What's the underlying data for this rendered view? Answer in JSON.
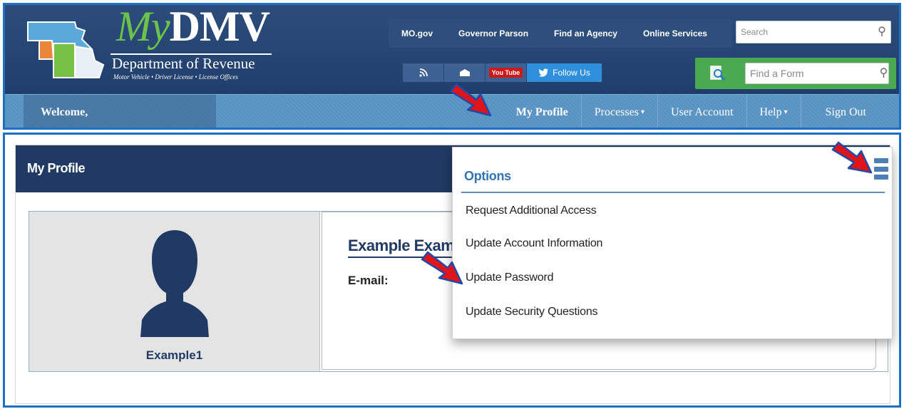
{
  "header": {
    "brand_my": "My",
    "brand_dmv": "DMV",
    "department": "Department of Revenue",
    "tagline": "Motor Vehicle  •  Driver License  •  License Offices",
    "util_links": [
      "MO.gov",
      "Governor Parson",
      "Find an Agency",
      "Online Services"
    ],
    "site_search_placeholder": "Search",
    "social": {
      "rss_glyph": "ᖇ",
      "mail_glyph": "⏏",
      "youtube_label": "You Tube",
      "follow_label": "Follow Us"
    },
    "form_search_placeholder": "Find a Form"
  },
  "nav": {
    "welcome": "Welcome,",
    "items": [
      {
        "label": "My Profile"
      },
      {
        "label": "Processes",
        "dropdown": true
      },
      {
        "label": "User Account"
      },
      {
        "label": "Help",
        "dropdown": true
      },
      {
        "label": "Sign Out"
      }
    ]
  },
  "profile": {
    "title": "My Profile",
    "username": "Example1",
    "full_name": "Example Example",
    "email_label": "E-mail:"
  },
  "options_menu": {
    "title": "Options",
    "items": [
      "Request Additional Access",
      "Update Account Information",
      "Update Password",
      "Update Security Questions"
    ]
  },
  "colors": {
    "header_blue": "#213a63",
    "nav_blue": "#5f98c6",
    "accent_green": "#4aaa52",
    "frame_blue": "#1e6fc6",
    "arrow_red": "#e0141b"
  },
  "icons": [
    "search-icon",
    "rss-icon",
    "mail-icon",
    "youtube-icon",
    "twitter-icon",
    "find-form-icon",
    "hamburger-menu-icon",
    "avatar-silhouette-icon",
    "arrow-annotation"
  ]
}
